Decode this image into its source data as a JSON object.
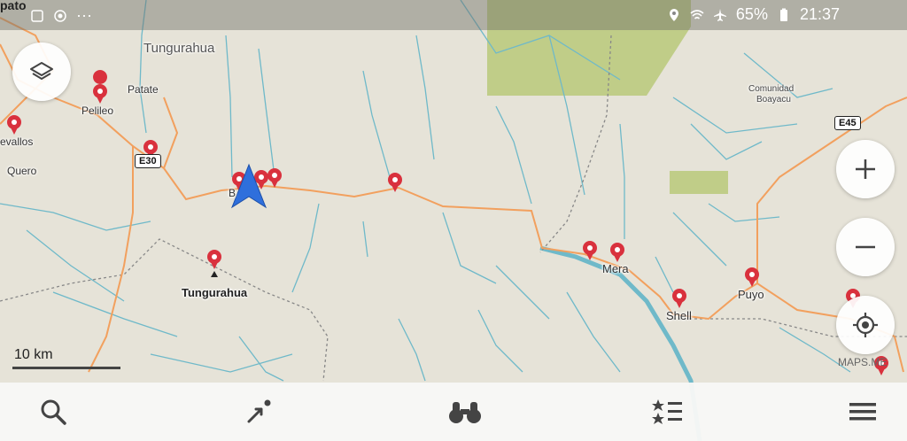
{
  "status_bar": {
    "location_text": "pato",
    "battery": "65%",
    "time": "21:37",
    "icons": [
      "location-icon",
      "wifi-icon",
      "airplane-icon",
      "battery-icon"
    ]
  },
  "map_labels": {
    "tungurahua_region": "Tungurahua",
    "patate": "Patate",
    "pelileo": "Pelileo",
    "cevallos": "evallos",
    "quero": "Quero",
    "banos": "B",
    "tungurahua_peak": "Tungurahua",
    "mera": "Mera",
    "shell": "Shell",
    "puyo": "Puyo",
    "comunidad": "Comunidad",
    "boayacu": "Boayacu"
  },
  "road_shields": {
    "e30": "E30",
    "e45": "E45"
  },
  "scale_label": "10 km",
  "watermark": "MAPS.ME",
  "colors": {
    "land": "#e6e3d8",
    "river": "#6fb9c9",
    "road": "#f2a05e",
    "park": "#b9c97a",
    "pin": "#d9313d",
    "arrow": "#2f6fdc"
  },
  "controls": {
    "layers": "layers-icon",
    "zoom_in": "plus-icon",
    "zoom_out": "minus-icon",
    "my_location": "crosshair-icon"
  },
  "bottom_nav": [
    "search-icon",
    "route-icon",
    "discovery-icon",
    "bookmarks-icon",
    "menu-icon"
  ]
}
